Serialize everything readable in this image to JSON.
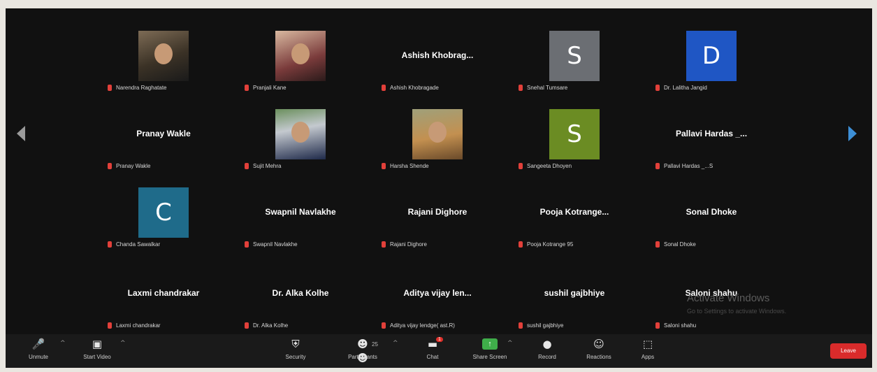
{
  "participants": [
    {
      "label": "Narendra Raghatate",
      "avatar": {
        "type": "photo",
        "style": "p1"
      }
    },
    {
      "label": "Pranjali Kane",
      "avatar": {
        "type": "photo",
        "style": "p2"
      }
    },
    {
      "label": "Ashish Khobragade",
      "display_name": "Ashish Khobrag..."
    },
    {
      "label": "Snehal Tumsare",
      "avatar": {
        "type": "letter",
        "letter": "S",
        "color": "#6b6e73"
      }
    },
    {
      "label": "Dr. Lalitha Jangid",
      "avatar": {
        "type": "letter",
        "letter": "D",
        "color": "#1f56c4"
      }
    },
    {
      "label": "Pranay Wakle",
      "display_name": "Pranay Wakle"
    },
    {
      "label": "Sujit Mehra",
      "avatar": {
        "type": "photo",
        "style": "p3"
      }
    },
    {
      "label": "Harsha Shende",
      "avatar": {
        "type": "photo",
        "style": "p4"
      }
    },
    {
      "label": "Sangeeta Dhoyen",
      "avatar": {
        "type": "letter",
        "letter": "S",
        "color": "#6b8c23"
      }
    },
    {
      "label": "Pallavi Hardas _...S",
      "display_name": "Pallavi Hardas _..."
    },
    {
      "label": "Chanda Sawalkar",
      "avatar": {
        "type": "letter",
        "letter": "C",
        "color": "#1f6b8a"
      }
    },
    {
      "label": "Swapnil Navlakhe",
      "display_name": "Swapnil Navlakhe"
    },
    {
      "label": "Rajani Dighore",
      "display_name": "Rajani Dighore"
    },
    {
      "label": "Pooja Kotrange 95",
      "display_name": "Pooja Kotrange..."
    },
    {
      "label": "Sonal Dhoke",
      "display_name": "Sonal Dhoke"
    },
    {
      "label": "Laxmi chandrakar",
      "display_name": "Laxmi chandrakar"
    },
    {
      "label": "Dr. Alka Kolhe",
      "display_name": "Dr. Alka Kolhe"
    },
    {
      "label": "Aditya vijay lendge( ast.R)",
      "display_name": "Aditya vijay len..."
    },
    {
      "label": "sushil gajbhiye",
      "display_name": "sushil gajbhiye"
    },
    {
      "label": "Saloni shahu",
      "display_name": "Saloni shahu"
    }
  ],
  "watermark": {
    "title": "Activate Windows",
    "subtitle": "Go to Settings to activate Windows."
  },
  "toolbar": {
    "unmute": "Unmute",
    "start_video": "Start Video",
    "security": "Security",
    "participants": "Participants",
    "participants_count": "25",
    "chat": "Chat",
    "chat_badge": "1",
    "share_screen": "Share Screen",
    "record": "Record",
    "reactions": "Reactions",
    "apps": "Apps",
    "leave": "Leave"
  },
  "colors": {
    "mute_indicator": "#e2403a",
    "leave_button": "#d92b2b",
    "share_screen": "#3fae4a"
  },
  "icons": {
    "nav_left": "chevron-left-icon",
    "nav_right": "chevron-right-icon",
    "muted_mic": "muted-mic-icon"
  }
}
